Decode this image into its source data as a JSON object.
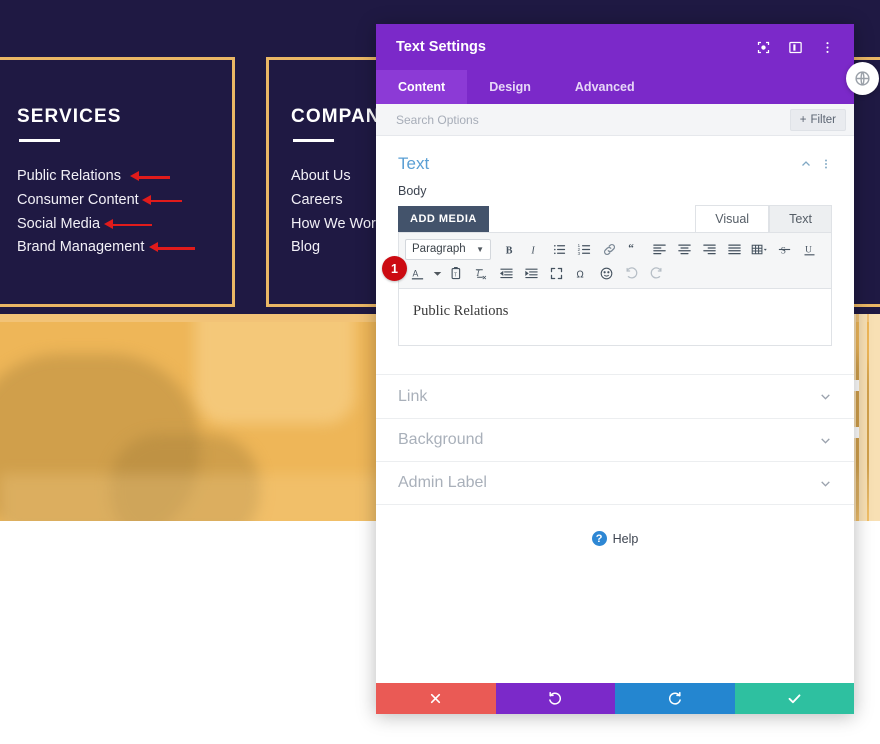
{
  "site": {
    "columns": [
      {
        "title": "SERVICES",
        "links": [
          {
            "label": "Public Relations",
            "arrow": true,
            "arrow_width": 40
          },
          {
            "label": "Consumer Content",
            "arrow": true,
            "arrow_width": 40
          },
          {
            "label": "Social Media",
            "arrow": true,
            "arrow_width": 48
          },
          {
            "label": "Brand Management",
            "arrow": true,
            "arrow_width": 46
          }
        ]
      },
      {
        "title": "COMPANY",
        "links": [
          {
            "label": "About Us",
            "arrow": false
          },
          {
            "label": "Careers",
            "arrow": false
          },
          {
            "label": "How We Work",
            "arrow": false
          },
          {
            "label": "Blog",
            "arrow": false
          }
        ]
      }
    ],
    "colors": {
      "footer_bg": "#1f1943",
      "border_gold": "#eab765",
      "photo_overlay": "#eeb658",
      "arrow_red": "#e01b1b"
    },
    "round_button_icon": "globe-icon"
  },
  "panel": {
    "title": "Text Settings",
    "header_icons": [
      "target-icon",
      "layout-panel-icon",
      "more-vertical-icon"
    ],
    "tabs": [
      {
        "label": "Content",
        "active": true
      },
      {
        "label": "Design",
        "active": false
      },
      {
        "label": "Advanced",
        "active": false
      }
    ],
    "search": {
      "placeholder": "Search Options",
      "value": "",
      "filter_label": "Filter"
    },
    "text_section": {
      "title": "Text",
      "collapse_icon": "chevron-up-icon",
      "more_icon": "more-vertical-icon",
      "field_label": "Body",
      "add_media_label": "ADD MEDIA",
      "editor_tabs": [
        {
          "label": "Visual",
          "active": true
        },
        {
          "label": "Text",
          "active": false
        }
      ],
      "toolbar_row1": [
        {
          "name": "format-select",
          "label": "Paragraph",
          "type": "select"
        },
        {
          "name": "bold-icon",
          "glyph": "B"
        },
        {
          "name": "italic-icon",
          "glyph": "I"
        },
        {
          "name": "bulleted-list-icon",
          "glyph": ""
        },
        {
          "name": "numbered-list-icon",
          "glyph": ""
        },
        {
          "name": "link-icon",
          "glyph": ""
        },
        {
          "name": "blockquote-icon",
          "glyph": "“"
        },
        {
          "name": "align-left-icon",
          "glyph": ""
        },
        {
          "name": "align-center-icon",
          "glyph": ""
        },
        {
          "name": "align-right-icon",
          "glyph": ""
        },
        {
          "name": "align-justify-icon",
          "glyph": ""
        },
        {
          "name": "table-icon",
          "glyph": ""
        },
        {
          "name": "strikethrough-icon",
          "glyph": "S"
        },
        {
          "name": "underline-icon",
          "glyph": "U"
        }
      ],
      "toolbar_row2": [
        {
          "name": "text-color-icon",
          "glyph": "A"
        },
        {
          "name": "paste-as-text-icon",
          "glyph": ""
        },
        {
          "name": "clear-formatting-icon",
          "glyph": ""
        },
        {
          "name": "outdent-icon",
          "glyph": ""
        },
        {
          "name": "indent-icon",
          "glyph": ""
        },
        {
          "name": "fullscreen-icon",
          "glyph": ""
        },
        {
          "name": "special-character-icon",
          "glyph": "Ω"
        },
        {
          "name": "emoji-icon",
          "glyph": "☺"
        },
        {
          "name": "undo-icon",
          "glyph": ""
        },
        {
          "name": "redo-icon",
          "glyph": ""
        }
      ],
      "content": "Public Relations",
      "badge": "1"
    },
    "accordions": [
      {
        "title": "Link",
        "chevron": "chevron-down-icon"
      },
      {
        "title": "Background",
        "chevron": "chevron-down-icon"
      },
      {
        "title": "Admin Label",
        "chevron": "chevron-down-icon"
      }
    ],
    "help_label": "Help",
    "actions": [
      {
        "name": "cancel-button",
        "icon": "close-icon",
        "color": "#ea5a55"
      },
      {
        "name": "undo-button",
        "icon": "undo-icon",
        "color": "#7b29c9"
      },
      {
        "name": "redo-button",
        "icon": "redo-icon",
        "color": "#2486d0"
      },
      {
        "name": "save-button",
        "icon": "check-icon",
        "color": "#2ec0a0"
      }
    ]
  }
}
